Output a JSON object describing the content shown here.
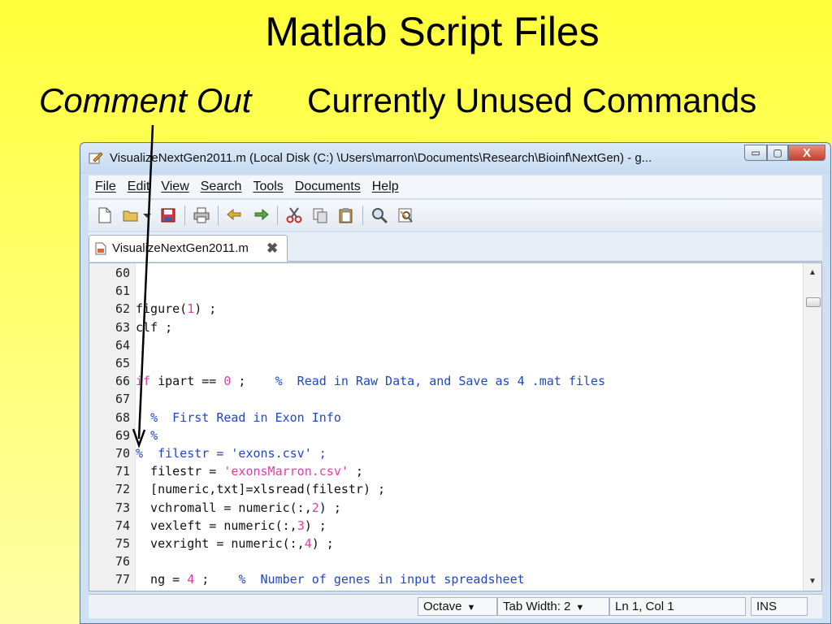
{
  "slide": {
    "title": "Matlab Script Files",
    "subtitle_italic": "Comment Out",
    "subtitle_plain": "Currently Unused Commands"
  },
  "window": {
    "title": "VisualizeNextGen2011.m (Local Disk (C:) \\Users\\marron\\Documents\\Research\\Bioinf\\NextGen) - g...",
    "minimize_label": "▭",
    "maximize_label": "▢",
    "close_label": "X"
  },
  "menu": [
    "File",
    "Edit",
    "View",
    "Search",
    "Tools",
    "Documents",
    "Help"
  ],
  "toolbar_icons": [
    "new-file-icon",
    "open-folder-icon",
    "dropdown-arrow-icon",
    "save-icon",
    "print-icon",
    "undo-icon",
    "redo-icon",
    "cut-icon",
    "copy-icon",
    "paste-icon",
    "find-icon",
    "find-replace-icon"
  ],
  "tab": {
    "label": "VisualizeNextGen2011.m",
    "close": "✖"
  },
  "editor": {
    "lines": [
      {
        "n": "60",
        "parts": []
      },
      {
        "n": "61",
        "parts": []
      },
      {
        "n": "62",
        "parts": [
          [
            "",
            "figure("
          ],
          [
            "num",
            "1"
          ],
          [
            "",
            ") ;"
          ]
        ]
      },
      {
        "n": "63",
        "parts": [
          [
            "",
            "clf ;"
          ]
        ]
      },
      {
        "n": "64",
        "parts": []
      },
      {
        "n": "65",
        "parts": []
      },
      {
        "n": "66",
        "parts": [
          [
            "kw",
            "if"
          ],
          [
            "",
            " ipart == "
          ],
          [
            "num",
            "0"
          ],
          [
            "",
            " ;    "
          ],
          [
            "cm",
            "%  Read in Raw Data, and Save as 4 .mat files"
          ]
        ]
      },
      {
        "n": "67",
        "parts": []
      },
      {
        "n": "68",
        "parts": [
          [
            "",
            "  "
          ],
          [
            "cm",
            "%  First Read in Exon Info"
          ]
        ]
      },
      {
        "n": "69",
        "parts": [
          [
            "",
            "  "
          ],
          [
            "cm",
            "%"
          ]
        ]
      },
      {
        "n": "70",
        "parts": [
          [
            "cm",
            "%  filestr = 'exons.csv' ;"
          ]
        ]
      },
      {
        "n": "71",
        "parts": [
          [
            "",
            "  filestr = "
          ],
          [
            "str",
            "'exonsMarron.csv'"
          ],
          [
            "",
            " ;"
          ]
        ]
      },
      {
        "n": "72",
        "parts": [
          [
            "",
            "  [numeric,txt]=xlsread(filestr) ;"
          ]
        ]
      },
      {
        "n": "73",
        "parts": [
          [
            "",
            "  vchromall = numeric(:,"
          ],
          [
            "num",
            "2"
          ],
          [
            "",
            ") ;"
          ]
        ]
      },
      {
        "n": "74",
        "parts": [
          [
            "",
            "  vexleft = numeric(:,"
          ],
          [
            "num",
            "3"
          ],
          [
            "",
            ") ;"
          ]
        ]
      },
      {
        "n": "75",
        "parts": [
          [
            "",
            "  vexright = numeric(:,"
          ],
          [
            "num",
            "4"
          ],
          [
            "",
            ") ;"
          ]
        ]
      },
      {
        "n": "76",
        "parts": []
      },
      {
        "n": "77",
        "parts": [
          [
            "",
            "  ng = "
          ],
          [
            "num",
            "4"
          ],
          [
            "",
            " ;    "
          ],
          [
            "cm",
            "%  Number of genes in input spreadsheet"
          ]
        ]
      }
    ]
  },
  "status": {
    "language": "Octave",
    "tab_width": "Tab Width:  2",
    "position": "Ln 1, Col 1",
    "mode": "INS"
  },
  "colors": {
    "background": "#ffff66",
    "comment": "#1e48c9",
    "literal": "#e53ba8"
  }
}
